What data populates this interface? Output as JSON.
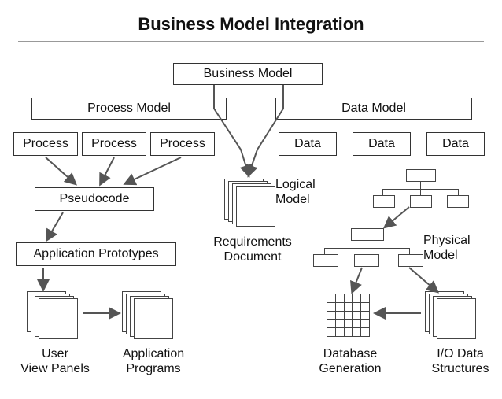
{
  "title": "Business Model Integration",
  "boxes": {
    "business_model": "Business Model",
    "process_model": "Process Model",
    "data_model": "Data Model",
    "process1": "Process",
    "process2": "Process",
    "process3": "Process",
    "data1": "Data",
    "data2": "Data",
    "data3": "Data",
    "pseudocode": "Pseudocode",
    "app_proto": "Application Prototypes"
  },
  "labels": {
    "req_doc": "Requirements\nDocument",
    "logical_model": "Logical\nModel",
    "physical_model": "Physical\nModel",
    "user_views": "User\nView Panels",
    "app_prog": "Application\nPrograms",
    "db_gen": "Database\nGeneration",
    "io_struct": "I/O Data\nStructures"
  }
}
